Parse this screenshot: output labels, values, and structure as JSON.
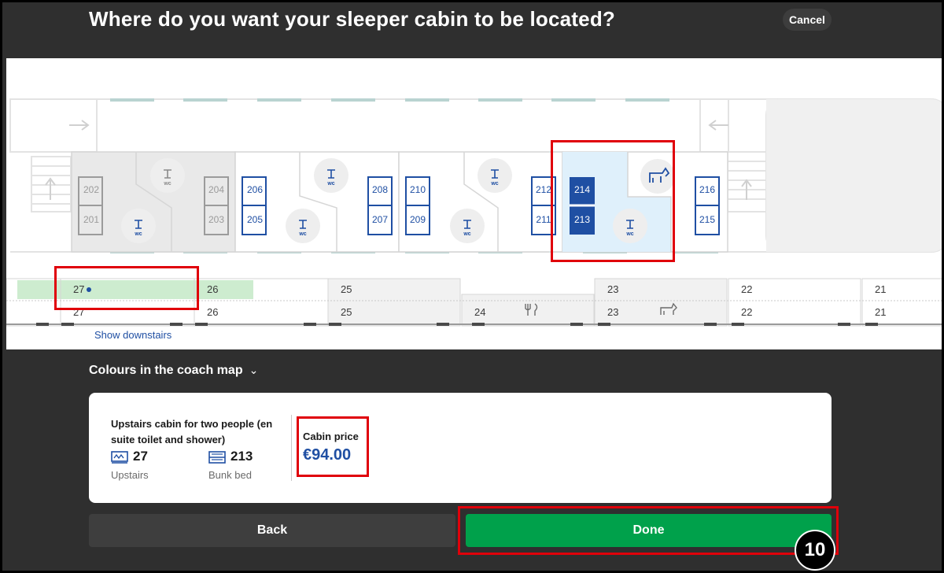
{
  "header": {
    "title": "Where do you want your sleeper cabin to be located?",
    "cancel_label": "Cancel"
  },
  "coach_map": {
    "cabins": [
      "202",
      "201",
      "204",
      "203",
      "206",
      "205",
      "208",
      "207",
      "210",
      "209",
      "212",
      "211",
      "214",
      "213",
      "216",
      "215"
    ],
    "selected_cabin": "213",
    "wc_label": "wc",
    "coaches_upper": [
      "27",
      "26",
      "25",
      "23",
      "22",
      "21"
    ],
    "coaches_lower": [
      "27",
      "26",
      "25",
      "24",
      "23",
      "22",
      "21"
    ],
    "selected_coach": "27",
    "show_downstairs_label": "Show downstairs",
    "colors": {
      "selected": "#1f4fa3",
      "selected_area": "#dff0fb",
      "available": "#1f4fa3",
      "unavailable": "#9b9b9b",
      "selected_coach_bg": "#cdeccf"
    }
  },
  "legend": {
    "title": "Colours in the coach map"
  },
  "summary": {
    "cabin_title": "Upstairs cabin for two people (en suite toilet and shower)",
    "coach_number": "27",
    "coach_sub": "Upstairs",
    "cabin_number": "213",
    "cabin_sub": "Bunk bed",
    "price_label": "Cabin price",
    "price_value": "€94.00",
    "icons": [
      "coach-icon",
      "bunk-bed-icon"
    ]
  },
  "actions": {
    "back_label": "Back",
    "done_label": "Done"
  },
  "step_badge": "10"
}
